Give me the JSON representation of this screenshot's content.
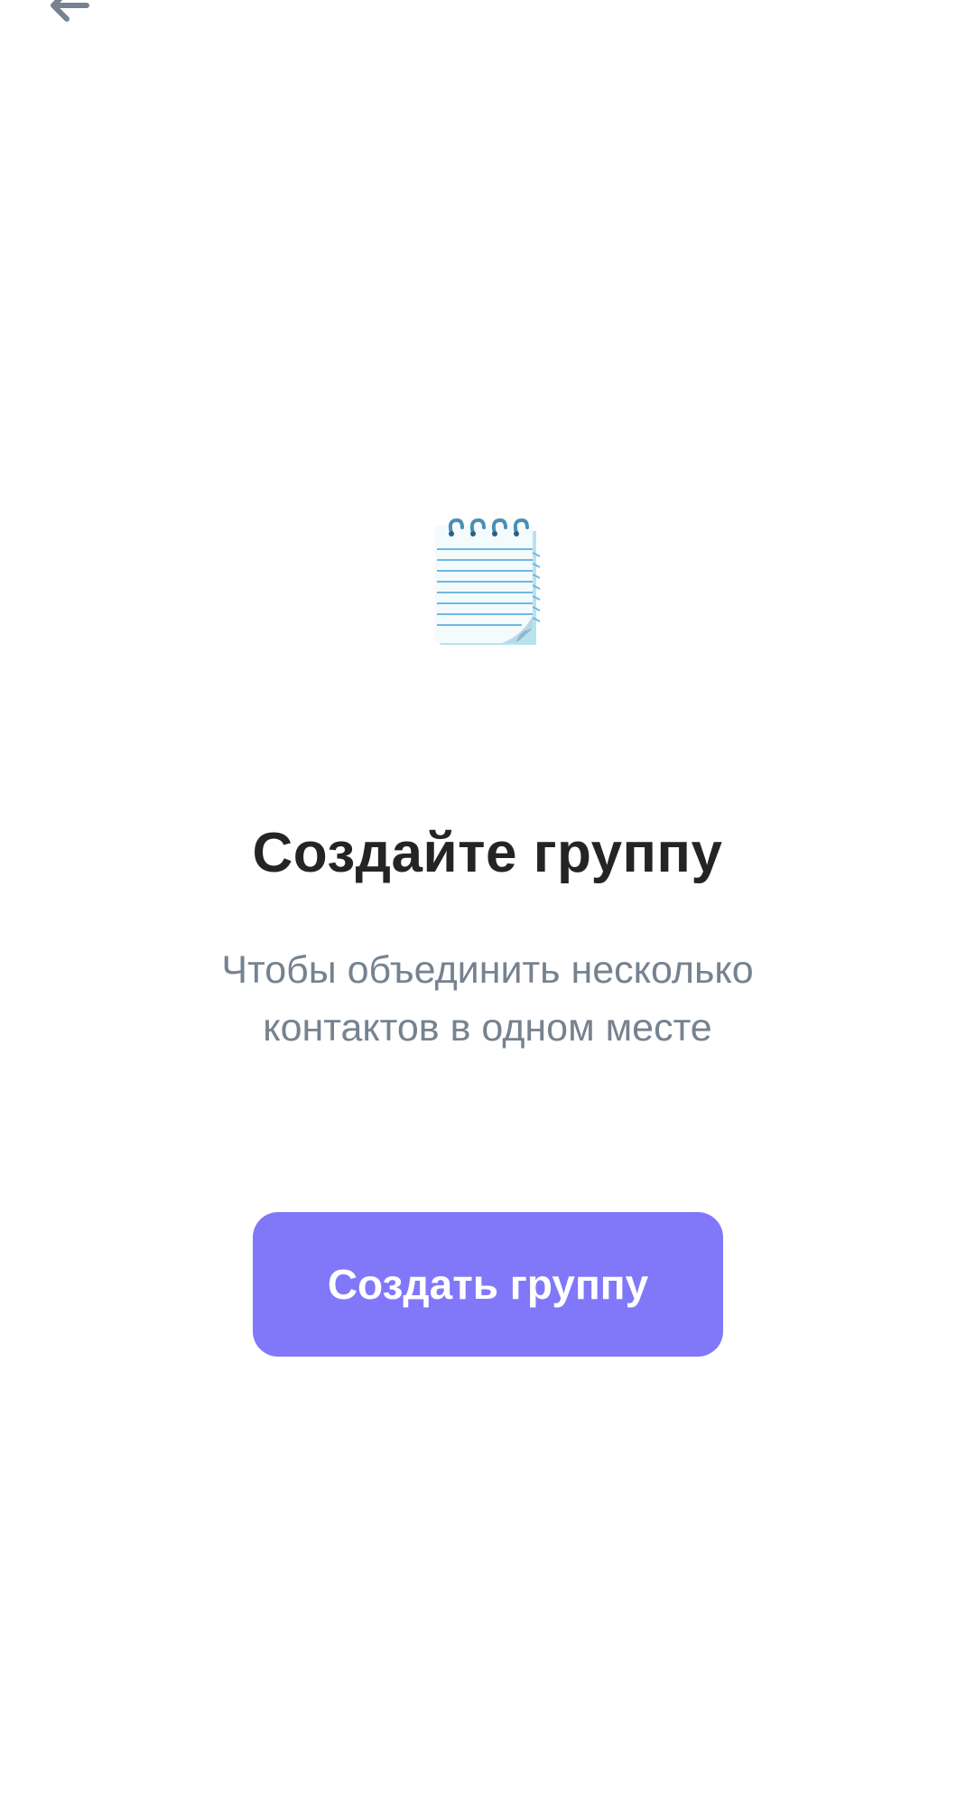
{
  "header": {
    "back_icon": "arrow-left-icon"
  },
  "empty_state": {
    "illustration": "spiral-notepad",
    "title": "Создайте группу",
    "subtitle_line1": "Чтобы объединить несколько",
    "subtitle_line2": "контактов в одном месте"
  },
  "actions": {
    "create_group_label": "Создать группу"
  },
  "colors": {
    "accent": "#8078f8",
    "title_text": "#222426",
    "subtitle_text": "#76828f",
    "icon": "#76828f"
  }
}
